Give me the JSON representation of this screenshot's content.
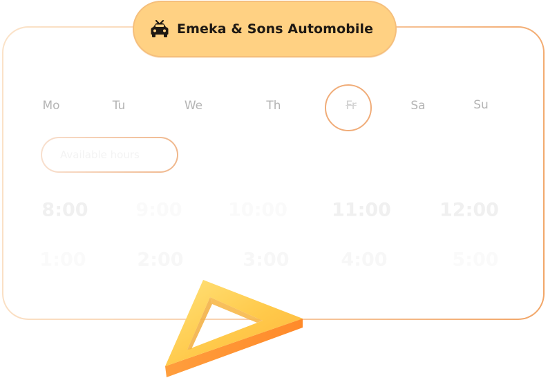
{
  "header": {
    "title": "Emeka & Sons Automobile",
    "icon": "car-icon"
  },
  "weekdays": [
    {
      "label": "Mo",
      "selected": false
    },
    {
      "label": "Tu",
      "selected": false
    },
    {
      "label": "We",
      "selected": false
    },
    {
      "label": "Th",
      "selected": false
    },
    {
      "label": "Fr",
      "selected": true
    },
    {
      "label": "Sa",
      "selected": false
    },
    {
      "label": "Su",
      "selected": false
    }
  ],
  "hours": {
    "label": "Available hours"
  },
  "time_slots": [
    "8:00",
    "9:00",
    "10:00",
    "11:00",
    "12:00",
    "1:00",
    "2:00",
    "3:00",
    "4:00",
    "5:00"
  ],
  "colors": {
    "accent": "#ffd183",
    "accent_border": "#f5bf7c",
    "ring": "#f0ac78",
    "text_dark": "#1e1813",
    "weekday_text": "#b4b4b4"
  }
}
